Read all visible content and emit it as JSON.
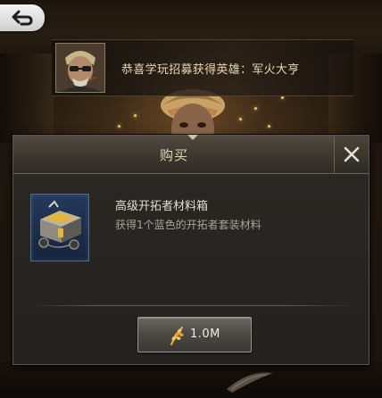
{
  "notification": {
    "text": "恭喜学玩招募获得英雄：军火大亨",
    "avatar_icon": "hero-portrait"
  },
  "navigation": {
    "back_icon": "back-arrow-icon"
  },
  "dialog": {
    "title": "购买",
    "close_icon": "close-x-icon",
    "item": {
      "name": "高级开拓者材料箱",
      "description": "获得1个蓝色的开拓者套装材料",
      "icon": "material-crate-icon"
    },
    "buy": {
      "price": "1.0M",
      "currency_icon": "wheat-icon"
    }
  },
  "colors": {
    "title_text": "#e3d5b6",
    "notice_text": "#e9d7b0",
    "item_frame_blue": "#4f6b8a",
    "accent_gold": "#e0a53a"
  }
}
